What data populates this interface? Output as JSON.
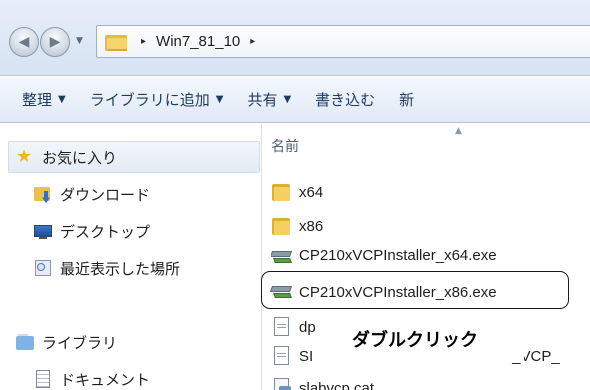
{
  "address_bar": {
    "back_glyph": "◀",
    "forward_glyph": "▶",
    "dropdown_glyph": "▼",
    "separator_glyph": "▸",
    "breadcrumbs": [
      "Win7_81_10"
    ]
  },
  "toolbar": {
    "items": [
      {
        "label": "整理",
        "caret": "▼"
      },
      {
        "label": "ライブラリに追加",
        "caret": "▼"
      },
      {
        "label": "共有",
        "caret": "▼"
      },
      {
        "label": "書き込む",
        "caret": ""
      },
      {
        "label": "新",
        "caret": ""
      }
    ]
  },
  "navigation_pane": {
    "favorites": {
      "label": "お気に入り",
      "icon": "star-icon"
    },
    "favorite_items": [
      {
        "label": "ダウンロード",
        "icon": "downloads-folder-icon"
      },
      {
        "label": "デスクトップ",
        "icon": "desktop-icon"
      },
      {
        "label": "最近表示した場所",
        "icon": "recent-places-icon"
      }
    ],
    "libraries": {
      "label": "ライブラリ",
      "icon": "library-icon"
    },
    "library_items": [
      {
        "label": "ドキュメント",
        "icon": "document-icon"
      }
    ]
  },
  "file_list": {
    "column_header": "名前",
    "sort_indicator": "▲",
    "files": [
      {
        "name": "x64",
        "icon": "folder-icon"
      },
      {
        "name": "x86",
        "icon": "folder-icon"
      },
      {
        "name": "CP210xVCPInstaller_x64.exe",
        "icon": "installer-icon"
      },
      {
        "name": "CP210xVCPInstaller_x86.exe",
        "icon": "installer-icon"
      },
      {
        "name": "dp",
        "icon": "text-file-icon"
      },
      {
        "name": "SI",
        "icon": "text-file-icon"
      },
      {
        "name": "slabvcp.cat",
        "icon": "catalog-file-icon"
      }
    ],
    "partial_text": "t_VCP_"
  },
  "annotation": {
    "callout_text": "ダブルクリック"
  },
  "colors": {
    "toolbar_text": "#1e3a5f",
    "folder": "#f5cf61",
    "favorites_star": "#f3b51c"
  }
}
